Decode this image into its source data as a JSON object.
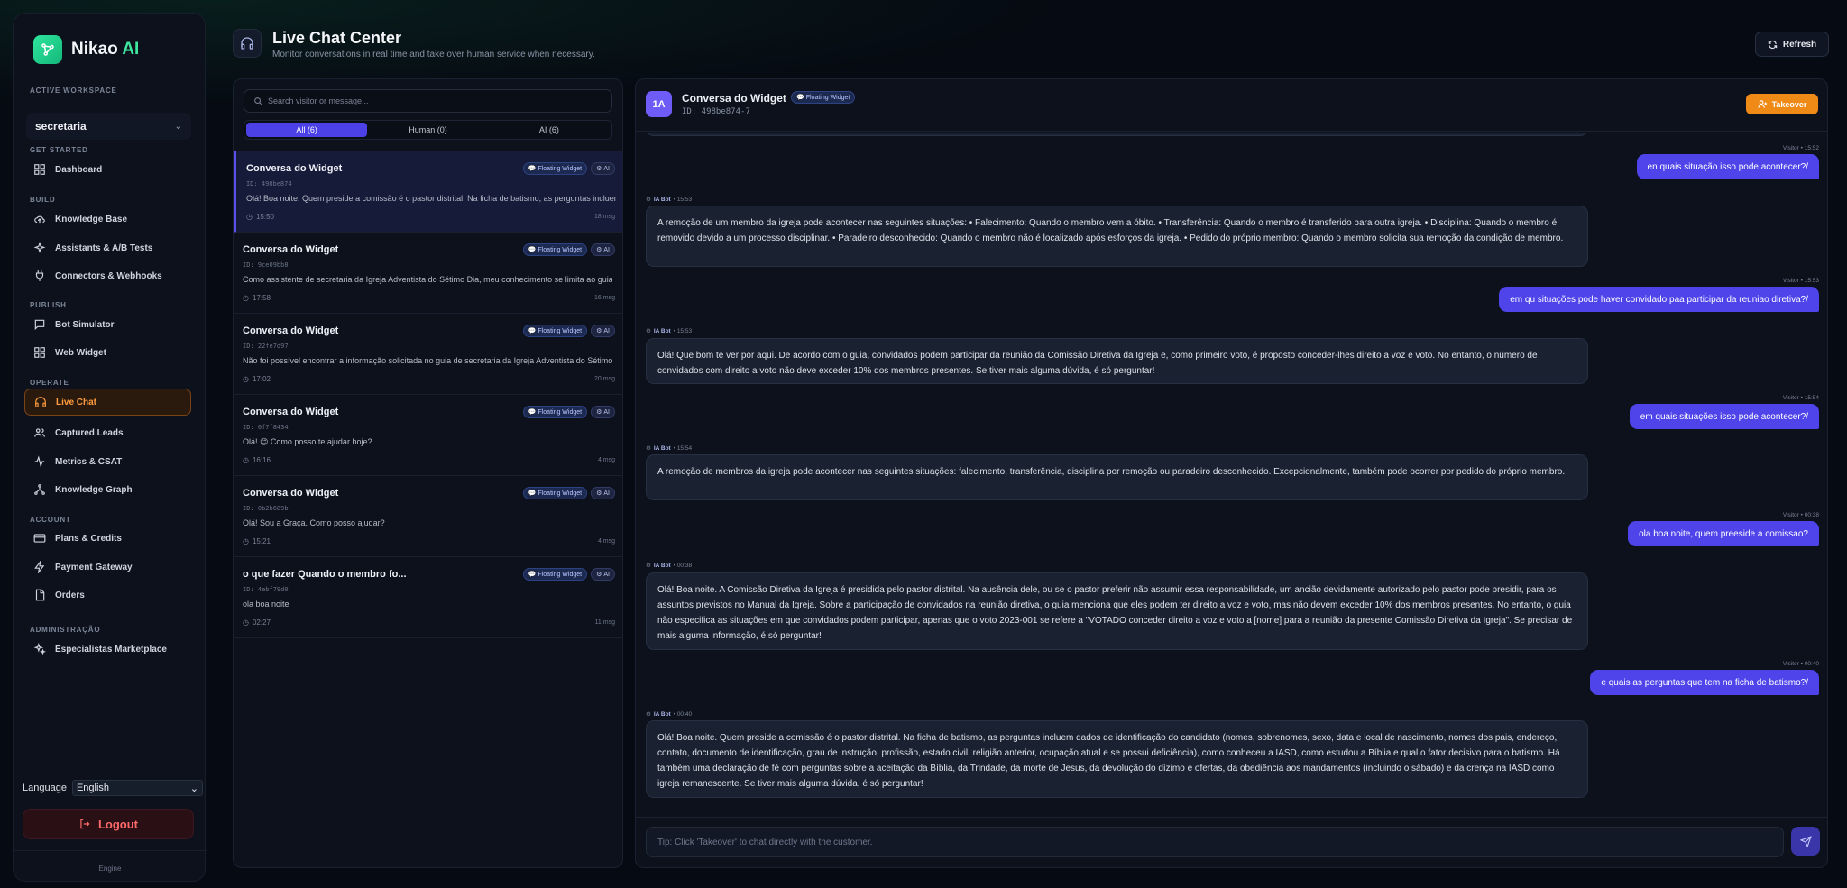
{
  "brand": {
    "name": "Nikao",
    "suffix": "AI"
  },
  "sidebar": {
    "workspace_label": "ACTIVE WORKSPACE",
    "workspace_value": "secretaria",
    "sections": {
      "get_started": "GET STARTED",
      "build": "BUILD",
      "publish": "PUBLISH",
      "operate": "OPERATE",
      "account": "ACCOUNT",
      "admin": "ADMINISTRAÇÃO"
    },
    "items": {
      "dashboard": "Dashboard",
      "knowledge_base": "Knowledge Base",
      "assistants": "Assistants & A/B Tests",
      "connectors": "Connectors & Webhooks",
      "bot_simulator": "Bot Simulator",
      "web_widget": "Web Widget",
      "live_chat": "Live Chat",
      "captured_leads": "Captured Leads",
      "metrics": "Metrics & CSAT",
      "knowledge_graph": "Knowledge Graph",
      "plans": "Plans & Credits",
      "payment": "Payment Gateway",
      "orders": "Orders",
      "marketplace": "Especialistas Marketplace"
    },
    "language_label": "Language",
    "language_value": "English",
    "logout_label": "Logout",
    "engine_label": "Engine"
  },
  "header": {
    "title": "Live Chat Center",
    "subtitle": "Monitor conversations in real time and take over human service when necessary.",
    "refresh_label": "Refresh"
  },
  "list": {
    "search_placeholder": "Search visitor or message...",
    "tabs": [
      "All (6)",
      "Human (0)",
      "AI (6)"
    ],
    "badge_widget": "Floating Widget",
    "badge_ai": "AI",
    "conversations": [
      {
        "title": "Conversa do Widget",
        "id": "ID: 498be874",
        "preview": "Olá! Boa noite. Quem preside a comissão é o pastor distrital. Na ficha de batismo, as perguntas incluem dados de identificação do candidato",
        "time": "15:50",
        "count": "18 msg"
      },
      {
        "title": "Conversa do Widget",
        "id": "ID: 9ce09bb8",
        "preview": "Como assistente de secretaria da Igreja Adventista do Sétimo Dia, meu conhecimento se limita ao guia de secretaria",
        "time": "17:58",
        "count": "16 msg"
      },
      {
        "title": "Conversa do Widget",
        "id": "ID: 22fe7d97",
        "preview": "Não foi possível encontrar a informação solicitada no guia de secretaria da Igreja Adventista do Sétimo Dia",
        "time": "17:02",
        "count": "20 msg"
      },
      {
        "title": "Conversa do Widget",
        "id": "ID: 0f7f8434",
        "preview": "Olá! 😊 Como posso te ajudar hoje?",
        "time": "16:16",
        "count": "4 msg"
      },
      {
        "title": "Conversa do Widget",
        "id": "ID: 0b2b689b",
        "preview": "Olá! Sou a Graça. Como posso ajudar?",
        "time": "15:21",
        "count": "4 msg"
      },
      {
        "title": "o que fazer Quando o membro fo...",
        "id": "ID: 4ebf79d0",
        "preview": "ola boa noite",
        "time": "02:27",
        "count": "11 msg"
      }
    ]
  },
  "chat": {
    "avatar": "1A",
    "name": "Conversa do Widget",
    "badge": "Floating Widget",
    "id": "ID: 498be874-7",
    "takeover_label": "Takeover",
    "input_placeholder": "Tip: Click 'Takeover' to chat directly with the customer.",
    "messages": [
      {
        "role": "user",
        "meta": "Visitor • 15:52",
        "text": "en quais situação isso pode acontecer?/"
      },
      {
        "role": "bot",
        "meta_name": "IA Bot",
        "meta_time": "• 15:53",
        "text": "A remoção de um membro da igreja pode acontecer nas seguintes situações: • Falecimento: Quando o membro vem a óbito. • Transferência: Quando o membro é transferido para outra igreja. • Disciplina: Quando o membro é removido devido a um processo disciplinar. • Paradeiro desconhecido: Quando o membro não é localizado após esforços da igreja. • Pedido do próprio membro: Quando o membro solicita sua remoção da condição de membro."
      },
      {
        "role": "user",
        "meta": "Visitor • 15:53",
        "text": "em qu situações pode haver convidado paa participar da reuniao diretiva?/"
      },
      {
        "role": "bot",
        "meta_name": "IA Bot",
        "meta_time": "• 15:53",
        "text": "Olá! Que bom te ver por aqui. De acordo com o guia, convidados podem participar da reunião da Comissão Diretiva da Igreja e, como primeiro voto, é proposto conceder-lhes direito a voz e voto. No entanto, o número de convidados com direito a voto não deve exceder 10% dos membros presentes. Se tiver mais alguma dúvida, é só perguntar!"
      },
      {
        "role": "user",
        "meta": "Visitor • 15:54",
        "text": "em quais situações isso pode acontecer?/"
      },
      {
        "role": "bot",
        "meta_name": "IA Bot",
        "meta_time": "• 15:54",
        "text": "A remoção de membros da igreja pode acontecer nas seguintes situações: falecimento, transferência, disciplina por remoção ou paradeiro desconhecido. Excepcionalmente, também pode ocorrer por pedido do próprio membro."
      },
      {
        "role": "user",
        "meta": "Visitor • 00:38",
        "text": "ola boa noite, quem preeside a comissao?"
      },
      {
        "role": "bot",
        "meta_name": "IA Bot",
        "meta_time": "• 00:38",
        "text": "Olá! Boa noite. A Comissão Diretiva da Igreja é presidida pelo pastor distrital. Na ausência dele, ou se o pastor preferir não assumir essa responsabilidade, um ancião devidamente autorizado pelo pastor pode presidir, para os assuntos previstos no Manual da Igreja. Sobre a participação de convidados na reunião diretiva, o guia menciona que eles podem ter direito a voz e voto, mas não devem exceder 10% dos membros presentes. No entanto, o guia não especifica as situações em que convidados podem participar, apenas que o voto 2023-001 se refere a \"VOTADO conceder direito a voz e voto a [nome] para a reunião da presente Comissão Diretiva da Igreja\". Se precisar de mais alguma informação, é só perguntar!"
      },
      {
        "role": "user",
        "meta": "Visitor • 00:40",
        "text": "e quais as perguntas que tem na ficha de batismo?/"
      },
      {
        "role": "bot",
        "meta_name": "IA Bot",
        "meta_time": "• 00:40",
        "text": "Olá! Boa noite. Quem preside a comissão é o pastor distrital. Na ficha de batismo, as perguntas incluem dados de identificação do candidato (nomes, sobrenomes, sexo, data e local de nascimento, nomes dos pais, endereço, contato, documento de identificação, grau de instrução, profissão, estado civil, religião anterior, ocupação atual e se possui deficiência), como conheceu a IASD, como estudou a Bíblia e qual o fator decisivo para o batismo. Há também uma declaração de fé com perguntas sobre a aceitação da Bíblia, da Trindade, da morte de Jesus, da devolução do dízimo e ofertas, da obediência aos mandamentos (incluindo o sábado) e da crença na IASD como igreja remanescente. Se tiver mais alguma dúvida, é só perguntar!"
      }
    ]
  },
  "colors": {
    "accent_purple": "#4e44ea",
    "accent_orange": "#f08a17",
    "brand_green": "#2ee59d",
    "danger_red": "#ff6b6b"
  }
}
